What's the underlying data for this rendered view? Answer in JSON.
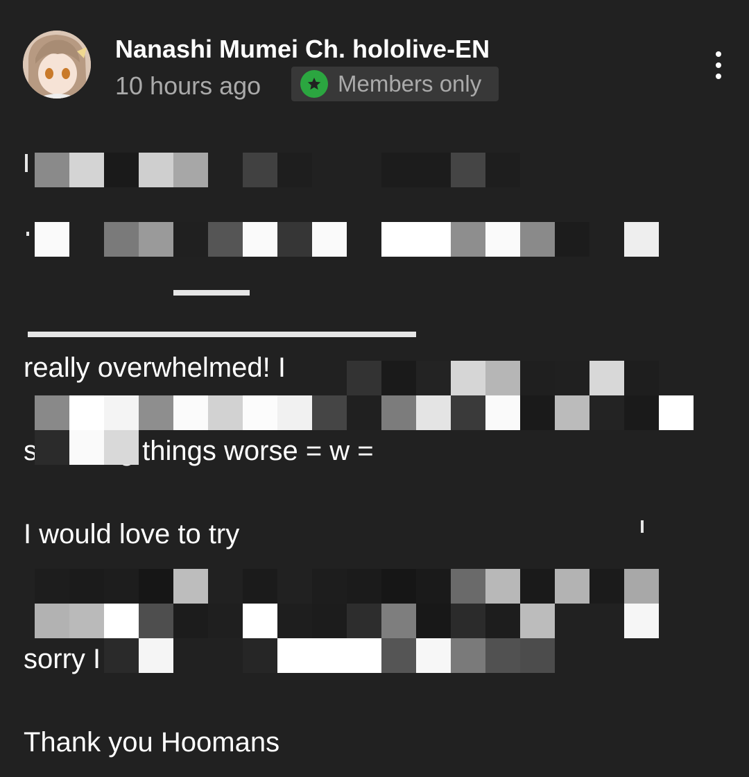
{
  "post": {
    "channel_name": "Nanashi Mumei Ch. hololive-EN",
    "timestamp": "10 hours ago",
    "badge": {
      "label": "Members only",
      "icon": "star-icon",
      "color": "#2ba640"
    },
    "menu_icon": "more-vertical-icon",
    "lines": {
      "overwhelmed": "really overwhelmed! I",
      "worse": "s making things worse = w =",
      "try": "I would love to try",
      "sorry": "sorry I",
      "thanks": "Thank you Hoomans"
    }
  },
  "colors": {
    "background": "#212121",
    "text": "#ffffff",
    "secondary_text": "#aaaaaa",
    "badge_bg": "#383838"
  }
}
